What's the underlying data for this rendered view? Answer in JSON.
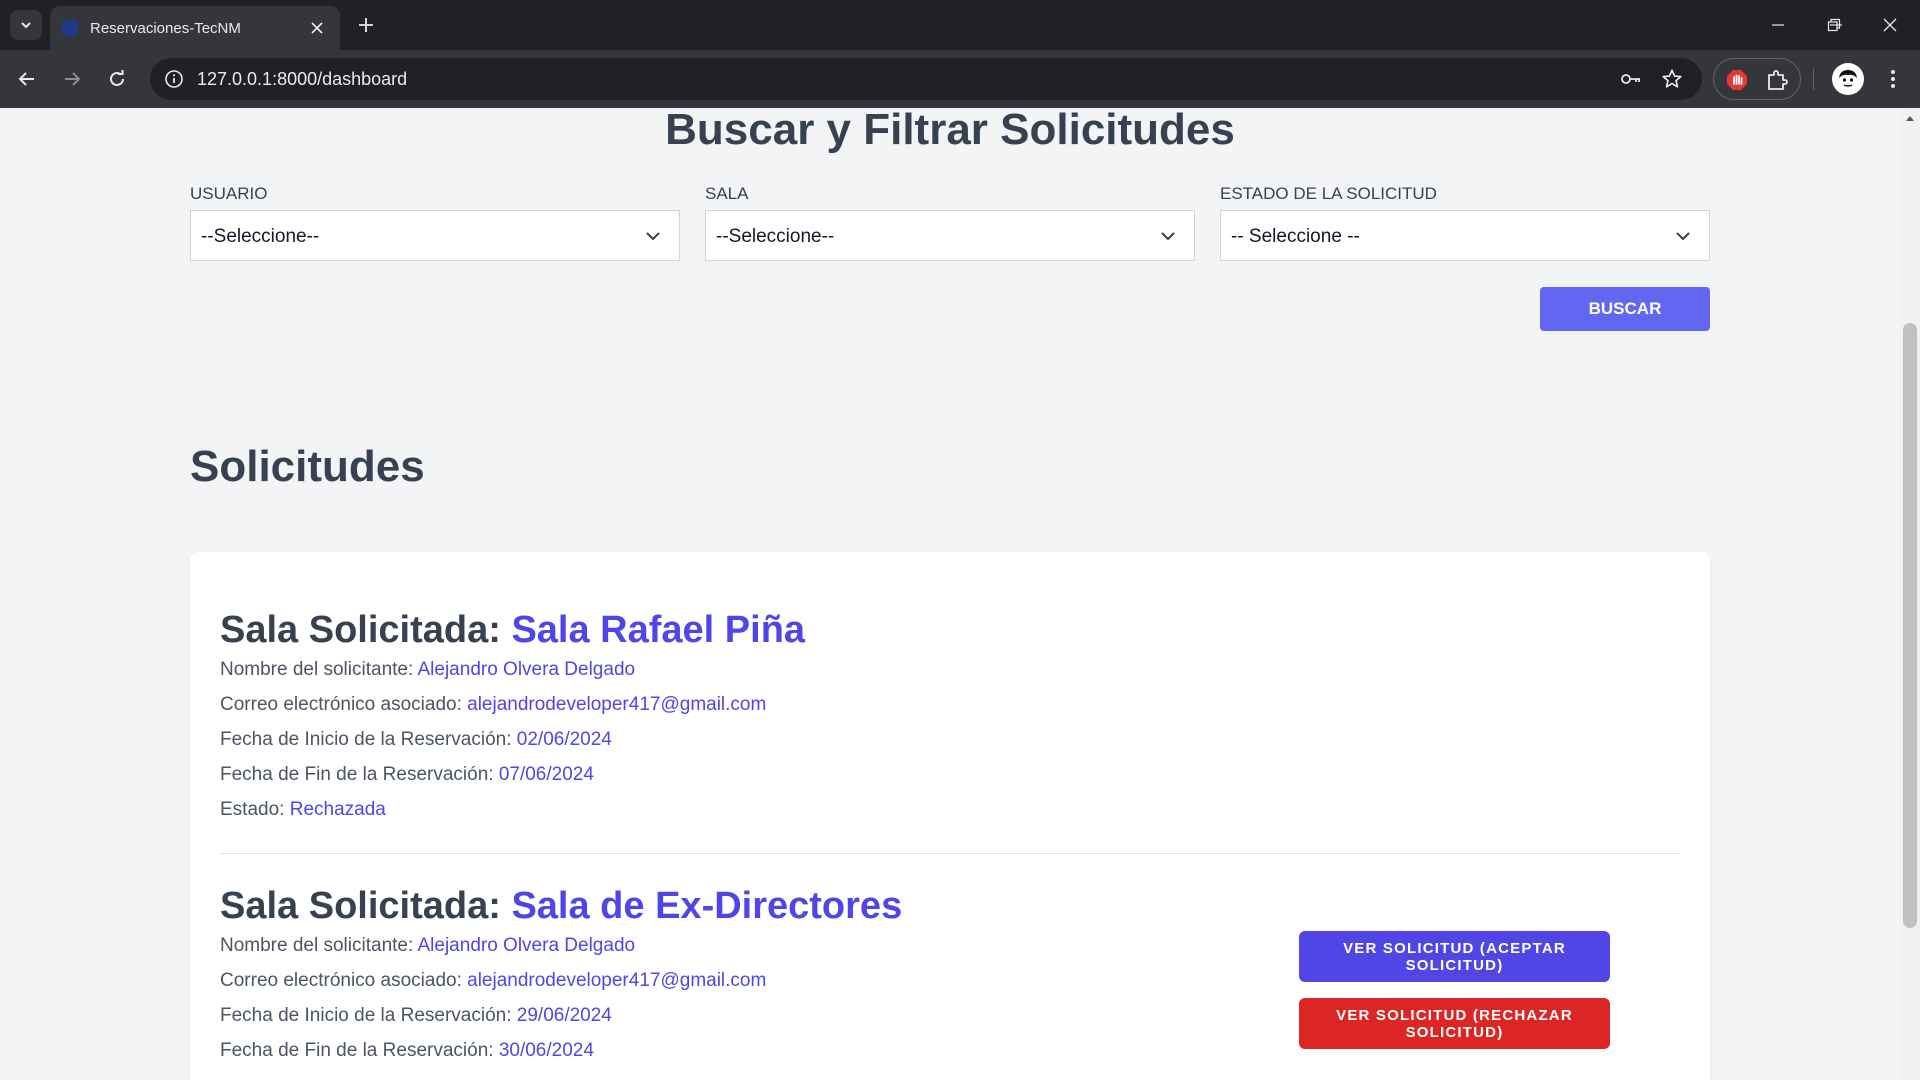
{
  "browser": {
    "tab_title": "Reservaciones-TecNM",
    "url": "127.0.0.1:8000/dashboard"
  },
  "filters": {
    "title": "Buscar y Filtrar Solicitudes",
    "usuario": {
      "label": "USUARIO",
      "value": "--Seleccione--"
    },
    "sala": {
      "label": "SALA",
      "value": "--Seleccione--"
    },
    "estado": {
      "label": "ESTADO DE LA SOLICITUD",
      "value": "-- Seleccione --"
    },
    "search_button": "BUSCAR"
  },
  "solicitudes": {
    "title": "Solicitudes",
    "items": [
      {
        "heading_label": "Sala Solicitada: ",
        "sala": "Sala Rafael Piña",
        "solicitante_label": "Nombre del solicitante: ",
        "solicitante": "Alejandro Olvera Delgado",
        "correo_label": "Correo electrónico asociado: ",
        "correo": "alejandrodeveloper417@gmail.com",
        "inicio_label": "Fecha de Inicio de la Reservación: ",
        "inicio": "02/06/2024",
        "fin_label": "Fecha de Fin de la Reservación: ",
        "fin": "07/06/2024",
        "estado_label": "Estado: ",
        "estado": "Rechazada"
      },
      {
        "heading_label": "Sala Solicitada: ",
        "sala": "Sala de Ex-Directores",
        "solicitante_label": "Nombre del solicitante: ",
        "solicitante": "Alejandro Olvera Delgado",
        "correo_label": "Correo electrónico asociado: ",
        "correo": "alejandrodeveloper417@gmail.com",
        "inicio_label": "Fecha de Inicio de la Reservación: ",
        "inicio": "29/06/2024",
        "fin_label": "Fecha de Fin de la Reservación: ",
        "fin": "30/06/2024",
        "accept_button": "VER SOLICITUD (ACEPTAR SOLICITUD)",
        "reject_button": "VER SOLICITUD (RECHAZAR SOLICITUD)"
      }
    ]
  },
  "colors": {
    "accent": "#4f46e5",
    "search_button": "#6366f1",
    "reject_button": "#dc2626",
    "heading_text": "#374151"
  }
}
